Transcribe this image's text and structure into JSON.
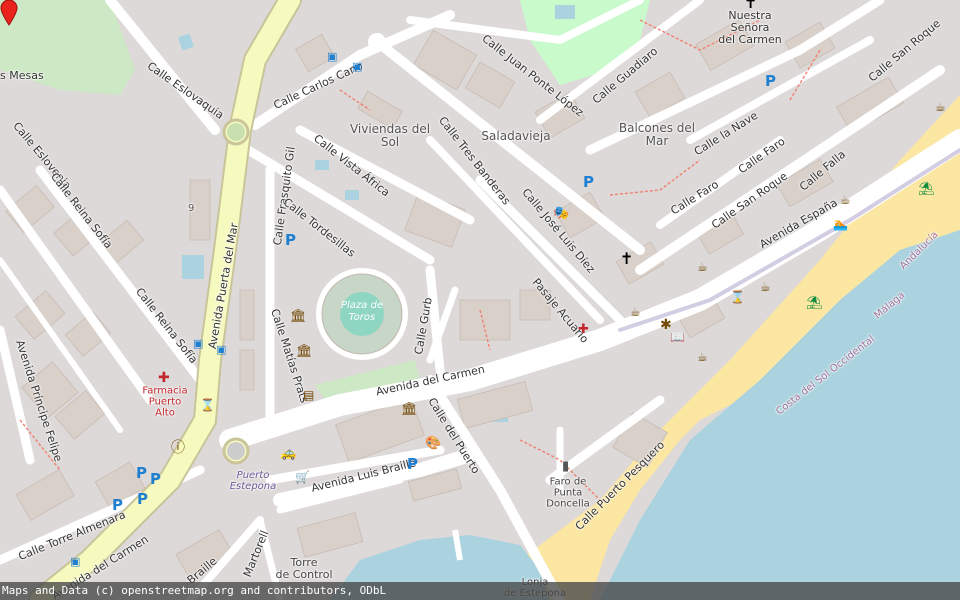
{
  "map": {
    "attribution": "Maps and Data (c) openstreetmap.org and contributors, ODbL",
    "colors": {
      "land": "#ddd9d8",
      "water": "#aad3df",
      "beach": "#fbe6a2",
      "park": "#c8facc",
      "road": "#ffffff",
      "primary": "#f7fabf",
      "building": "#d9d0c9"
    },
    "streets": {
      "eslovaquia": "Calle Eslovaquia",
      "carlos_cano": "Calle Carlos Cano",
      "juan_ponte": "Calle Juan Ponte López",
      "guadiaro": "Calle Guadiaro",
      "san_roque_top": "Calle San Roque",
      "eslovenia": "Calle Eslovenia",
      "reina_sofia_1": "Calle Reina Sofía",
      "reina_sofia_2": "Calle Reina Sofía",
      "puerta_del_mar": "Avenida Puerta del Mar",
      "frasquito_gil": "Calle Frasquito Gil",
      "vista_africa": "Calle Vista África",
      "tordesillas": "Calle Tordesillas",
      "tres_banderas": "Calle Tres Banderas",
      "jose_luis_diez": "Calle José Luis Díez",
      "la_nave": "Calle la Nave",
      "faro_1": "Calle Faro",
      "faro_2": "Calle Faro",
      "falla": "Calle Falla",
      "san_roque_mid": "Calle San Roque",
      "avenida_espana": "Avenida España",
      "matias_prats": "Calle Matías Prats",
      "gurb": "Calle Gurb",
      "pasaje_acuario": "Pasaje Acuario",
      "avenida_carmen": "Avenida del Carmen",
      "avenida_principe": "Avenida Príncipe Felipe",
      "calle_puerto": "Calle del Puerto",
      "luis_braille": "Avenida Luis Braille",
      "puerto_pesquero": "Calle Puerto Pesquero",
      "torre_almenara": "Calle Torre Almenara",
      "avenida_carmen_2": "Avenida del Carmen",
      "braille_2": "Braille",
      "martorell": "Martorell"
    },
    "places": {
      "tres_mesas": "s Mesas",
      "nuestra_senora_1": "Nuestra",
      "nuestra_senora_2": "Señora",
      "nuestra_senora_3": "del Carmen",
      "viviendas_1": "Viviendas del",
      "viviendas_2": "Sol",
      "saladavieja": "Saladavieja",
      "balcones_1": "Balcones del",
      "balcones_2": "Mar",
      "plaza_toros_1": "Plaza de",
      "plaza_toros_2": "Toros",
      "farmacia_1": "Farmacia",
      "farmacia_2": "Puerto",
      "farmacia_3": "Alto",
      "puerto_estepona_1": "Puerto",
      "puerto_estepona_2": "Estepona",
      "faro_1": "Faro de",
      "faro_2": "Punta",
      "faro_3": "Doncella",
      "torre_control_1": "Torre",
      "torre_control_2": "de Control",
      "lonja_1": "Lonja",
      "lonja_2": "de Estepona",
      "costa_sol": "Costa del Sol Occidental",
      "malaga": "Málaga",
      "andalucia": "Andalucía",
      "number_9": "9"
    },
    "icons": [
      "parking-icon",
      "bus-stop-icon",
      "church-icon",
      "pharmacy-icon",
      "museum-icon",
      "cafe-icon",
      "beach-umbrella-icon",
      "lighthouse-icon",
      "info-icon",
      "taxi-icon",
      "shop-icon",
      "art-icon",
      "swimmer-icon",
      "location-pin-icon"
    ]
  }
}
